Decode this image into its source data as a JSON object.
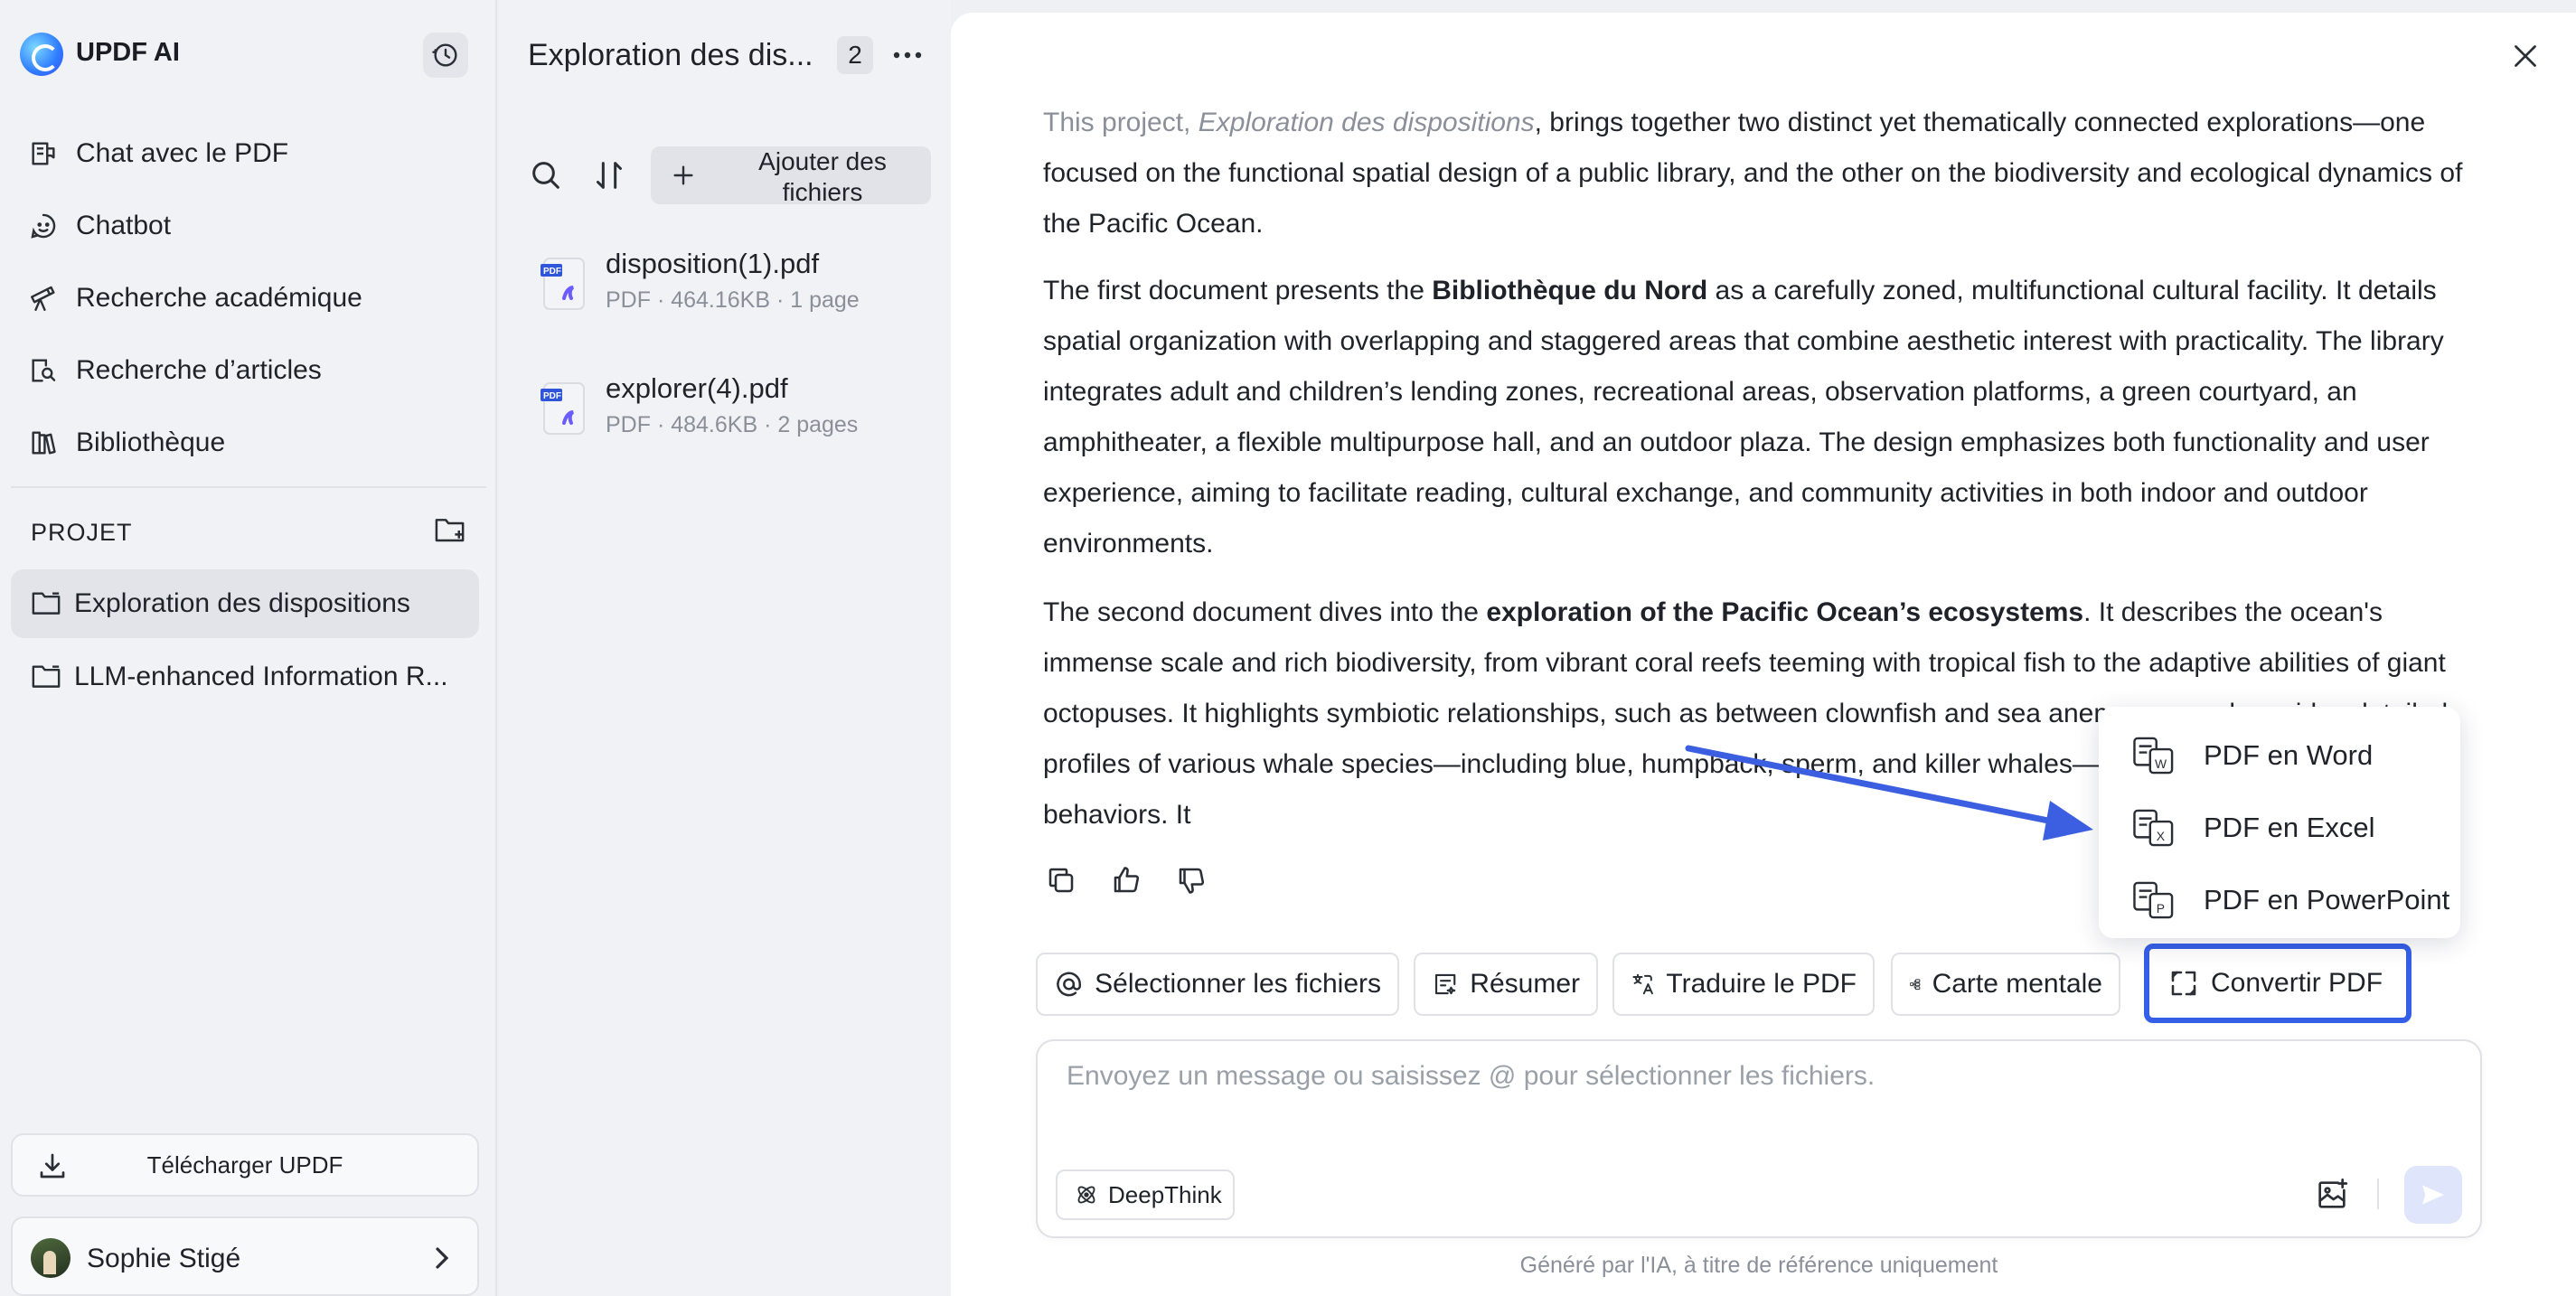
{
  "app": {
    "name": "UPDF AI"
  },
  "sidebar": {
    "nav": [
      {
        "label": "Chat avec le PDF",
        "icon": "book-chat-icon"
      },
      {
        "label": "Chatbot",
        "icon": "chatbot-icon"
      },
      {
        "label": "Recherche académique",
        "icon": "telescope-icon"
      },
      {
        "label": "Recherche d’articles",
        "icon": "article-search-icon"
      },
      {
        "label": "Bibliothèque",
        "icon": "library-icon"
      }
    ],
    "project_heading": "PROJET",
    "projects": [
      {
        "label": "Exploration des dispositions",
        "active": true
      },
      {
        "label": "LLM-enhanced Information R...",
        "active": false
      }
    ],
    "download_label": "Télécharger UPDF",
    "user_name": "Sophie Stigé"
  },
  "files_panel": {
    "title": "Exploration des dis...",
    "count": "2",
    "add_files_label": "Ajouter des fichiers",
    "files": [
      {
        "name": "disposition(1).pdf",
        "meta": "PDF · 464.16KB · 1 page"
      },
      {
        "name": "explorer(4).pdf",
        "meta": "PDF · 484.6KB · 2 pages"
      }
    ]
  },
  "chat": {
    "p1_start": "This project, ",
    "p1_italic": "Exploration des dispositions",
    "p1_rest": ", brings together two distinct yet thematically connected explorations—one focused on the functional spatial design of a public library, and the other on the biodiversity and ecological dynamics of the Pacific Ocean.",
    "p2_start": "The first document presents the ",
    "p2_bold": "Bibliothèque du Nord",
    "p2_rest": " as a carefully zoned, multifunctional cultural facility. It details spatial organization with overlapping and staggered areas that combine aesthetic interest with practicality. The library integrates adult and children’s lending zones, recreational areas, observation platforms, a green courtyard, an amphitheater, a flexible multipurpose hall, and an outdoor plaza. The design emphasizes both functionality and user experience, aiming to facilitate reading, cultural exchange, and community activities in both indoor and outdoor environments.",
    "p3_start": "The second document dives into the ",
    "p3_bold": "exploration of the Pacific Ocean’s ecosystems",
    "p3_rest": ". It describes the ocean's immense scale and rich biodiversity, from vibrant coral reefs teeming with tropical fish to the adaptive abilities of giant octopuses. It highlights symbiotic relationships, such as between clownfish and sea anemones, and provides detailed profiles of various whale species—including blue, humpback, sperm, and killer whales—their physical traits and behaviors. It"
  },
  "actions": {
    "select_files": "Sélectionner les fichiers",
    "summarize": "Résumer",
    "translate": "Traduire le PDF",
    "mind_map": "Carte mentale",
    "convert": "Convertir PDF"
  },
  "convert_menu": [
    {
      "label": "PDF en Word",
      "icon": "pdf-to-word-icon",
      "letter": "W"
    },
    {
      "label": "PDF en Excel",
      "icon": "pdf-to-excel-icon",
      "letter": "X"
    },
    {
      "label": "PDF en PowerPoint",
      "icon": "pdf-to-powerpoint-icon",
      "letter": "P"
    }
  ],
  "composer": {
    "placeholder": "Envoyez un message ou saisissez @ pour sélectionner les fichiers.",
    "deepthink_label": "DeepThink"
  },
  "footer_note": "Généré par l'IA, à titre de référence uniquement",
  "colors": {
    "accent": "#3560e6",
    "arrow": "#3b5fe0",
    "sidebar_bg": "#f1f2f5",
    "main_bg": "#ffffff"
  }
}
